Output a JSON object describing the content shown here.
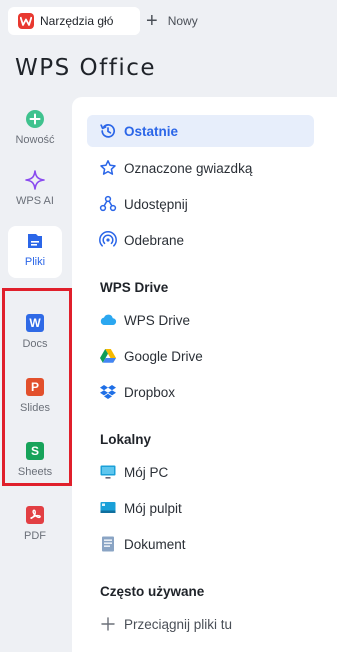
{
  "tabs": {
    "active_label": "Narzędzia głó",
    "new_label": "Nowy"
  },
  "brand": "WPS Office",
  "rail": {
    "items": [
      {
        "label": "Nowość",
        "icon": "plus-circle-icon"
      },
      {
        "label": "WPS AI",
        "icon": "sparkle-icon"
      },
      {
        "label": "Pliki",
        "icon": "files-icon"
      },
      {
        "label": "Docs",
        "icon": "docs-icon",
        "glyph": "W"
      },
      {
        "label": "Slides",
        "icon": "slides-icon",
        "glyph": "P"
      },
      {
        "label": "Sheets",
        "icon": "sheets-icon",
        "glyph": "S"
      },
      {
        "label": "PDF",
        "icon": "pdf-icon"
      }
    ]
  },
  "nav": {
    "recent": "Ostatnie",
    "starred": "Oznaczone gwiazdką",
    "shared": "Udostępnij",
    "received": "Odebrane"
  },
  "sections": {
    "drive_title": "WPS Drive",
    "drive_items": [
      "WPS Drive",
      "Google Drive",
      "Dropbox"
    ],
    "local_title": "Lokalny",
    "local_items": [
      "Mój PC",
      "Mój pulpit",
      "Dokument"
    ],
    "frequent_title": "Często używane",
    "drag_hint": "Przeciągnij pliki tu"
  },
  "colors": {
    "accent": "#2b66e8",
    "docs": "#2f6ae6",
    "slides": "#e2502c",
    "sheets": "#17a35a",
    "pdf": "#e23f43",
    "highlight": "#e01f2b"
  }
}
